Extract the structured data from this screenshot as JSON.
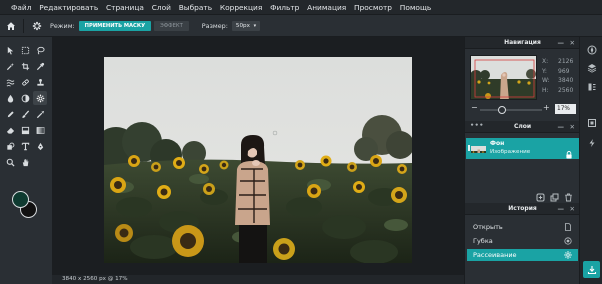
{
  "menu": [
    "Файл",
    "Редактировать",
    "Страница",
    "Слой",
    "Выбрать",
    "Коррекция",
    "Фильтр",
    "Анимация",
    "Просмотр",
    "Помощь"
  ],
  "toolbar": {
    "mode_label": "Режим:",
    "apply_mask": "ПРИМЕНИТЬ МАСКУ",
    "effect": "ЭФФЕКТ",
    "size_label": "Размер:",
    "size_value": "50px"
  },
  "canvas": {
    "status": "3840 x 2560 px @ 17%"
  },
  "navigator": {
    "title": "Навигация",
    "x_label": "X:",
    "x_value": "2126",
    "y_label": "Y:",
    "y_value": "969",
    "w_label": "W:",
    "w_value": "3840",
    "h_label": "H:",
    "h_value": "2560",
    "zoom_value": "17%",
    "zoom_level": 0.17
  },
  "layers": {
    "title": "Слои",
    "items": [
      {
        "name": "Фон",
        "type": "Изображение"
      }
    ]
  },
  "history": {
    "title": "История",
    "items": [
      {
        "label": "Открыть",
        "icon": "file-icon"
      },
      {
        "label": "Губка",
        "icon": "sponge-icon"
      },
      {
        "label": "Рассеивание",
        "icon": "gear-icon"
      }
    ]
  },
  "colors": {
    "accent": "#1aa3a4",
    "foreground": "#0e3a30",
    "background": "#111111"
  }
}
